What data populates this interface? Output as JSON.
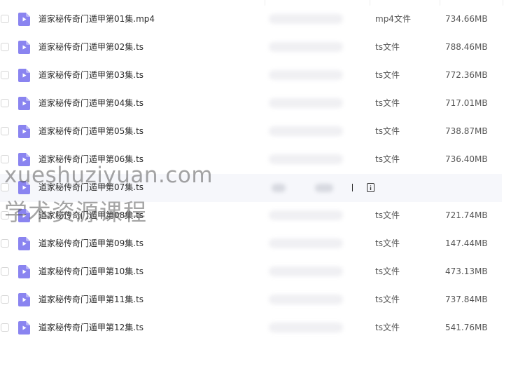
{
  "theme": {
    "icon_color": "#8a84f0",
    "row_hover_bg": "#f6f7fb",
    "text_color": "#2b2b2b",
    "meta_color": "#555555"
  },
  "files": [
    {
      "name": "道家秘传奇门遁甲第01集.mp4",
      "type": "mp4文件",
      "size": "734.66MB",
      "icon": "video-file-icon"
    },
    {
      "name": "道家秘传奇门遁甲第02集.ts",
      "type": "ts文件",
      "size": "788.46MB",
      "icon": "video-file-icon"
    },
    {
      "name": "道家秘传奇门遁甲第03集.ts",
      "type": "ts文件",
      "size": "772.36MB",
      "icon": "video-file-icon"
    },
    {
      "name": "道家秘传奇门遁甲第04集.ts",
      "type": "ts文件",
      "size": "717.01MB",
      "icon": "video-file-icon"
    },
    {
      "name": "道家秘传奇门遁甲第05集.ts",
      "type": "ts文件",
      "size": "738.87MB",
      "icon": "video-file-icon"
    },
    {
      "name": "道家秘传奇门遁甲第06集.ts",
      "type": "ts文件",
      "size": "736.40MB",
      "icon": "video-file-icon"
    },
    {
      "name": "道家秘传奇门遁甲第07集.ts",
      "type": "",
      "size": "",
      "icon": "video-file-icon",
      "hovered": true
    },
    {
      "name": "道家秘传奇门遁甲第08集.ts",
      "type": "ts文件",
      "size": "721.74MB",
      "icon": "video-file-icon"
    },
    {
      "name": "道家秘传奇门遁甲第09集.ts",
      "type": "ts文件",
      "size": "147.44MB",
      "icon": "video-file-icon"
    },
    {
      "name": "道家秘传奇门遁甲第10集.ts",
      "type": "ts文件",
      "size": "473.13MB",
      "icon": "video-file-icon"
    },
    {
      "name": "道家秘传奇门遁甲第11集.ts",
      "type": "ts文件",
      "size": "737.84MB",
      "icon": "video-file-icon"
    },
    {
      "name": "道家秘传奇门遁甲第12集.ts",
      "type": "ts文件",
      "size": "541.76MB",
      "icon": "video-file-icon"
    }
  ],
  "watermark": {
    "line1": "xueshuziyuan.com",
    "line2": "学术资源课程"
  }
}
